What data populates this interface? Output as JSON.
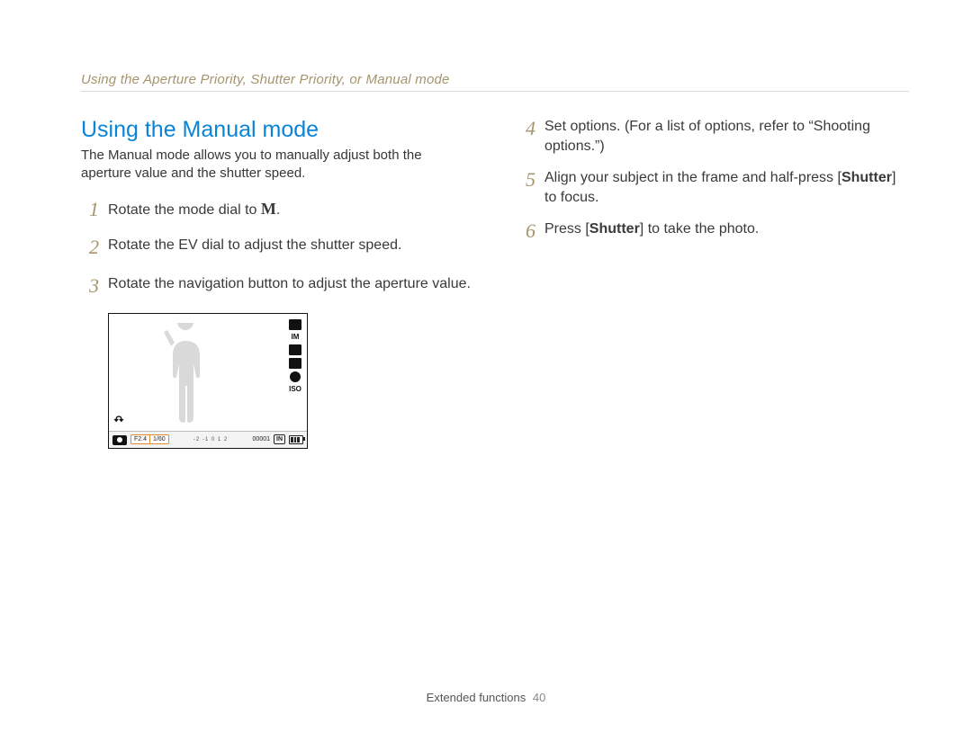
{
  "breadcrumb": "Using the Aperture Priority, Shutter Priority, or Manual mode",
  "section_title": "Using the Manual mode",
  "intro": "The Manual mode allows you to manually adjust both the aperture value and the shutter speed.",
  "steps_left": {
    "s1": {
      "num": "1",
      "pre": "Rotate the mode dial to ",
      "mode": "M",
      "post": "."
    },
    "s2": {
      "num": "2",
      "text": "Rotate the EV dial to adjust the shutter speed."
    },
    "s3": {
      "num": "3",
      "text": "Rotate the navigation button to adjust the aperture value."
    }
  },
  "steps_right": {
    "s4": {
      "num": "4",
      "text": "Set options. (For a list of options, refer to “Shooting options.”)"
    },
    "s5": {
      "num": "5",
      "pre": "Align your subject in the frame and half-press [",
      "bold": "Shutter",
      "post": "] to focus."
    },
    "s6": {
      "num": "6",
      "pre": "Press [",
      "bold": "Shutter",
      "post": "] to take the photo."
    }
  },
  "lcd": {
    "aperture": "F2.4",
    "shutter": "1/60",
    "ev_scale": "-2 -1  0  1  2",
    "counter": "00001",
    "in": "IN",
    "side_label": "IM",
    "iso_label": "ISO"
  },
  "footer": {
    "section": "Extended functions",
    "page": "40"
  }
}
